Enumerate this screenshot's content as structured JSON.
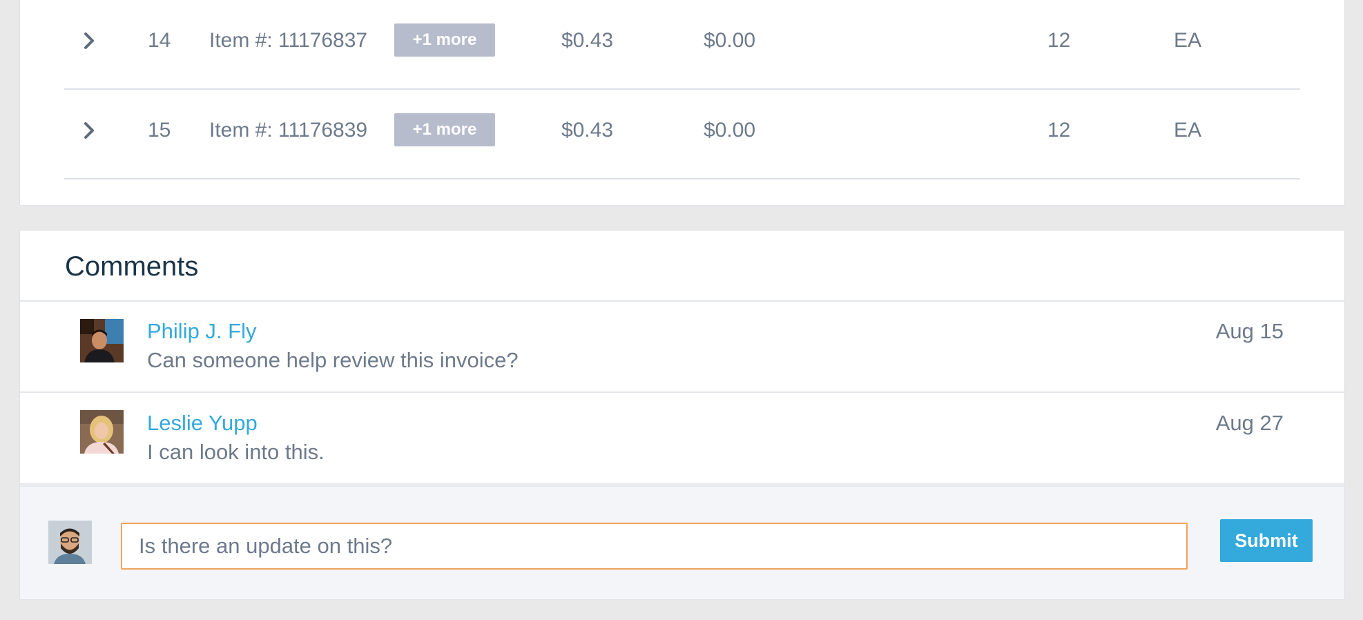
{
  "line_items": [
    {
      "line": "14",
      "item": "Item #: 11176837",
      "more": "+1 more",
      "unit_price": "$0.43",
      "price2": "$0.00",
      "qty": "12",
      "uom": "EA"
    },
    {
      "line": "15",
      "item": "Item #: 11176839",
      "more": "+1 more",
      "unit_price": "$0.43",
      "price2": "$0.00",
      "qty": "12",
      "uom": "EA"
    }
  ],
  "comments": {
    "title": "Comments",
    "list": [
      {
        "author": "Philip J. Fly",
        "text": "Can someone help review this invoice?",
        "date": "Aug 15"
      },
      {
        "author": "Leslie Yupp",
        "text": "I can look into this.",
        "date": "Aug 27"
      }
    ],
    "input_value": "Is there an update on this?",
    "submit_label": "Submit"
  },
  "colors": {
    "accent": "#33a9dc",
    "input_focus_border": "#f0a35a",
    "badge_bg": "#b6bccb",
    "title": "#1a3346",
    "text": "#6d7a8b",
    "page_bg": "#e9e9ea"
  },
  "icons": [
    "chevron-right-icon",
    "avatar-photo"
  ]
}
